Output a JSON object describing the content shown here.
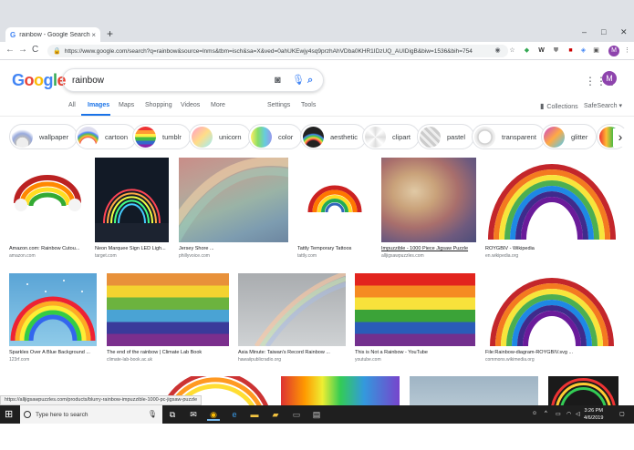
{
  "browser": {
    "tab_title": "rainbow - Google Search",
    "tab_close": "×",
    "new_tab": "+",
    "url": "https://www.google.com/search?q=rainbow&source=lnms&tbm=isch&sa=X&ved=0ahUKEwjy4sq9przhAhVDba0KHR1IDzUQ_AUIDigB&biw=1536&bih=754",
    "minimize": "–",
    "maximize": "□",
    "close": "✕",
    "back": "←",
    "forward": "→",
    "reload": "C",
    "profile_initial": "M"
  },
  "google": {
    "logo": [
      "G",
      "o",
      "o",
      "g",
      "l",
      "e"
    ],
    "logo_colors": [
      "#4285f4",
      "#ea4335",
      "#fbbc05",
      "#4285f4",
      "#34a853",
      "#ea4335"
    ],
    "query": "rainbow",
    "avatar_initial": "M"
  },
  "nav": {
    "all": "All",
    "images": "Images",
    "maps": "Maps",
    "shopping": "Shopping",
    "videos": "Videos",
    "more": "More",
    "settings": "Settings",
    "tools": "Tools",
    "collections": "Collections",
    "safesearch": "SafeSearch ▾"
  },
  "chips": [
    {
      "label": "wallpaper"
    },
    {
      "label": "cartoon"
    },
    {
      "label": "tumblr"
    },
    {
      "label": "unicorn"
    },
    {
      "label": "color"
    },
    {
      "label": "aesthetic"
    },
    {
      "label": "clipart"
    },
    {
      "label": "pastel"
    },
    {
      "label": "transparent"
    },
    {
      "label": "glitter"
    }
  ],
  "results_row1": [
    {
      "caption": "Amazon.com: Rainbow Cutou...",
      "source": "amazon.com"
    },
    {
      "caption": "Neon Marquee Sign LED Ligh...",
      "source": "target.com"
    },
    {
      "caption": "Jersey Shore ...",
      "source": "phillyvoice.com"
    },
    {
      "caption": "Tattly Temporary Tattoos",
      "source": "tattly.com"
    },
    {
      "caption": "Impuzzible - 1000 Piece Jigsaw Puzzle",
      "source": "alljigsawpuzzles.com"
    },
    {
      "caption": "ROYGBIV - Wikipedia",
      "source": "en.wikipedia.org"
    }
  ],
  "results_row2": [
    {
      "caption": "Sparkles Over A Blue Background ...",
      "source": "123rf.com"
    },
    {
      "caption": "The end of the rainbow | Climate Lab Book",
      "source": "climate-lab-book.ac.uk"
    },
    {
      "caption": "Asia Minute: Taiwan's Record Rainbow ...",
      "source": "hawaiipublicradio.org"
    },
    {
      "caption": "This is Not a Rainbow - YouTube",
      "source": "youtube.com"
    },
    {
      "caption": "File:Rainbow-diagram-ROYGBIV.svg ...",
      "source": "commons.wikimedia.org"
    }
  ],
  "status_url": "https://alljigsawpuzzles.com/products/blurry-rainbow-impuzzible-1000-pc-jigsaw-puzzle",
  "taskbar": {
    "search_placeholder": "Type here to search",
    "time": "3:26 PM",
    "date": "4/6/2019"
  },
  "colors": {
    "accent": "#1a73e8",
    "taskbar": "#1f1f1f"
  }
}
